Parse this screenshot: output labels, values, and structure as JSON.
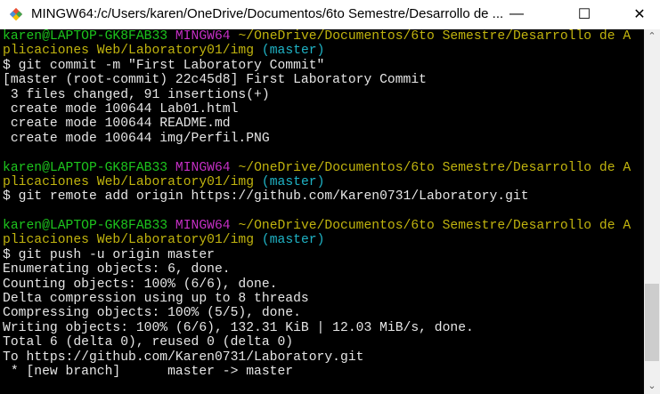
{
  "window": {
    "title": "MINGW64:/c/Users/karen/OneDrive/Documentos/6to Semestre/Desarrollo de ...",
    "minimize_icon": "minimize-icon",
    "maximize_icon": "maximize-icon",
    "close_icon": "close-icon",
    "minimize": "—",
    "maximize": "☐",
    "close": "✕"
  },
  "colors": {
    "green": "#1dc41d",
    "magenta": "#c42fc4",
    "yellow": "#c1b40e",
    "cyan": "#1fb2c4",
    "text": "#e6e6e6",
    "background": "#000000"
  },
  "scrollbar": {
    "position_fraction": 0.93
  },
  "terminal": {
    "lines": [
      [
        [
          "green",
          "karen@LAPTOP-GK8FAB33"
        ],
        [
          "white",
          " "
        ],
        [
          "magenta",
          "MINGW64"
        ],
        [
          "white",
          " "
        ],
        [
          "yellow",
          "~/OneDrive/Documentos/6to Semestre/Desarrollo de A"
        ]
      ],
      [
        [
          "yellow",
          "plicaciones Web/Laboratory01/img"
        ],
        [
          "white",
          " "
        ],
        [
          "cyan",
          "(master)"
        ]
      ],
      [
        [
          "white",
          "$ git commit -m \"First Laboratory Commit\""
        ]
      ],
      [
        [
          "white",
          "[master (root-commit) 22c45d8] First Laboratory Commit"
        ]
      ],
      [
        [
          "white",
          " 3 files changed, 91 insertions(+)"
        ]
      ],
      [
        [
          "white",
          " create mode 100644 Lab01.html"
        ]
      ],
      [
        [
          "white",
          " create mode 100644 README.md"
        ]
      ],
      [
        [
          "white",
          " create mode 100644 img/Perfil.PNG"
        ]
      ],
      [],
      [
        [
          "green",
          "karen@LAPTOP-GK8FAB33"
        ],
        [
          "white",
          " "
        ],
        [
          "magenta",
          "MINGW64"
        ],
        [
          "white",
          " "
        ],
        [
          "yellow",
          "~/OneDrive/Documentos/6to Semestre/Desarrollo de A"
        ]
      ],
      [
        [
          "yellow",
          "plicaciones Web/Laboratory01/img"
        ],
        [
          "white",
          " "
        ],
        [
          "cyan",
          "(master)"
        ]
      ],
      [
        [
          "white",
          "$ git remote add origin https://github.com/Karen0731/Laboratory.git"
        ]
      ],
      [],
      [
        [
          "green",
          "karen@LAPTOP-GK8FAB33"
        ],
        [
          "white",
          " "
        ],
        [
          "magenta",
          "MINGW64"
        ],
        [
          "white",
          " "
        ],
        [
          "yellow",
          "~/OneDrive/Documentos/6to Semestre/Desarrollo de A"
        ]
      ],
      [
        [
          "yellow",
          "plicaciones Web/Laboratory01/img"
        ],
        [
          "white",
          " "
        ],
        [
          "cyan",
          "(master)"
        ]
      ],
      [
        [
          "white",
          "$ git push -u origin master"
        ]
      ],
      [
        [
          "white",
          "Enumerating objects: 6, done."
        ]
      ],
      [
        [
          "white",
          "Counting objects: 100% (6/6), done."
        ]
      ],
      [
        [
          "white",
          "Delta compression using up to 8 threads"
        ]
      ],
      [
        [
          "white",
          "Compressing objects: 100% (5/5), done."
        ]
      ],
      [
        [
          "white",
          "Writing objects: 100% (6/6), 132.31 KiB | 12.03 MiB/s, done."
        ]
      ],
      [
        [
          "white",
          "Total 6 (delta 0), reused 0 (delta 0)"
        ]
      ],
      [
        [
          "white",
          "To https://github.com/Karen0731/Laboratory.git"
        ]
      ],
      [
        [
          "white",
          " * [new branch]      master -> master"
        ]
      ]
    ]
  }
}
